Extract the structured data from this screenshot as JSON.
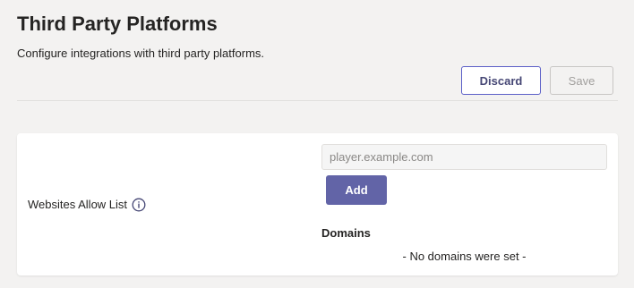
{
  "header": {
    "title": "Third Party Platforms",
    "subtitle": "Configure integrations with third party platforms."
  },
  "actions": {
    "discard_label": "Discard",
    "save_label": "Save"
  },
  "allow_list": {
    "label": "Websites Allow List",
    "info_icon": "info-icon",
    "input_value": "",
    "input_placeholder": "player.example.com",
    "add_label": "Add",
    "domains_heading": "Domains",
    "empty_text": "- No domains were set -"
  },
  "colors": {
    "accent": "#6264a7",
    "discard_border": "#5b5fc7",
    "background": "#f3f2f1"
  }
}
